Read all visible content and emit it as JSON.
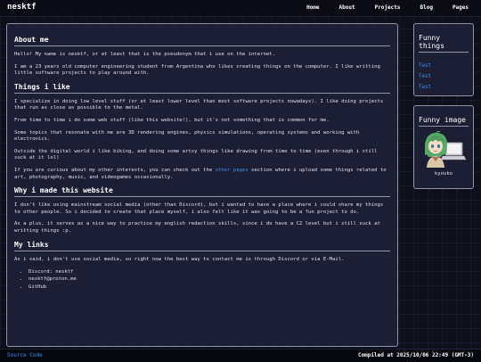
{
  "header": {
    "brand": "nesktf",
    "nav": [
      "Home",
      "About",
      "Projects",
      "Blog",
      "Pages"
    ]
  },
  "main": {
    "sections": [
      {
        "title": "About me",
        "paragraphs": [
          "Hello! My name is nesktf, or at least that is the pseudonym that i use on the internet.",
          "I am a 23 years old computer engineering student from Argentina who likes creating things on the computer. I like writting little software projects to play around with."
        ]
      },
      {
        "title": "Things i like",
        "paragraphs": [
          "I specialize in doing low level stuff (or at least lower level than most software projects nowadays). I like doing projects that run as close as possible to the metal.",
          "From time to time i do some web stuff (like this website!), but it's not something that is common for me.",
          "Some topics that resonate with me are 3D rendering engines, physics simulations, operating systems and working with electronics.",
          "Outside the digital world i like biking, and doing some artsy things like drawing from time to time (even through i still suck at it lol)"
        ],
        "pages_paragraph": {
          "before": "If you are curious about my other interests, you can check out the ",
          "link": "other pages",
          "after": " section where i upload some things related to art, photography, music, and videogames occasionally."
        }
      },
      {
        "title": "Why i made this website",
        "paragraphs": [
          "I don't like using mainstream social media (other than Discord), but i wanted to have a place where i could share my things to other people. So i decided to create that place myself, i also felt like it was going to be a fun project to do.",
          "As a plus, it serves as a nice way to practice my english redaction skills, since i do have a C2 level but i still suck at writting things :p."
        ]
      },
      {
        "title": "My links",
        "paragraphs": [
          "As i said, i don't use social media, so right now the best way to contact me is through Discord or via E-Mail."
        ],
        "links": [
          "Discord: nesktf",
          "nesktf@proton.me",
          "GitHub"
        ]
      }
    ]
  },
  "sidebar": {
    "funny_things": {
      "title": "Funny things",
      "items": [
        "Test",
        "Test",
        "Test"
      ]
    },
    "funny_image": {
      "title": "Funny image",
      "caption": "kyouko"
    }
  },
  "footer": {
    "source": "Source Code",
    "compiled": "Compiled at 2025/10/06 22:49 (GMT-3)"
  },
  "colors": {
    "link": "#3a8ef0",
    "panel": "#1c1e33",
    "background": "#0d0f1a"
  }
}
